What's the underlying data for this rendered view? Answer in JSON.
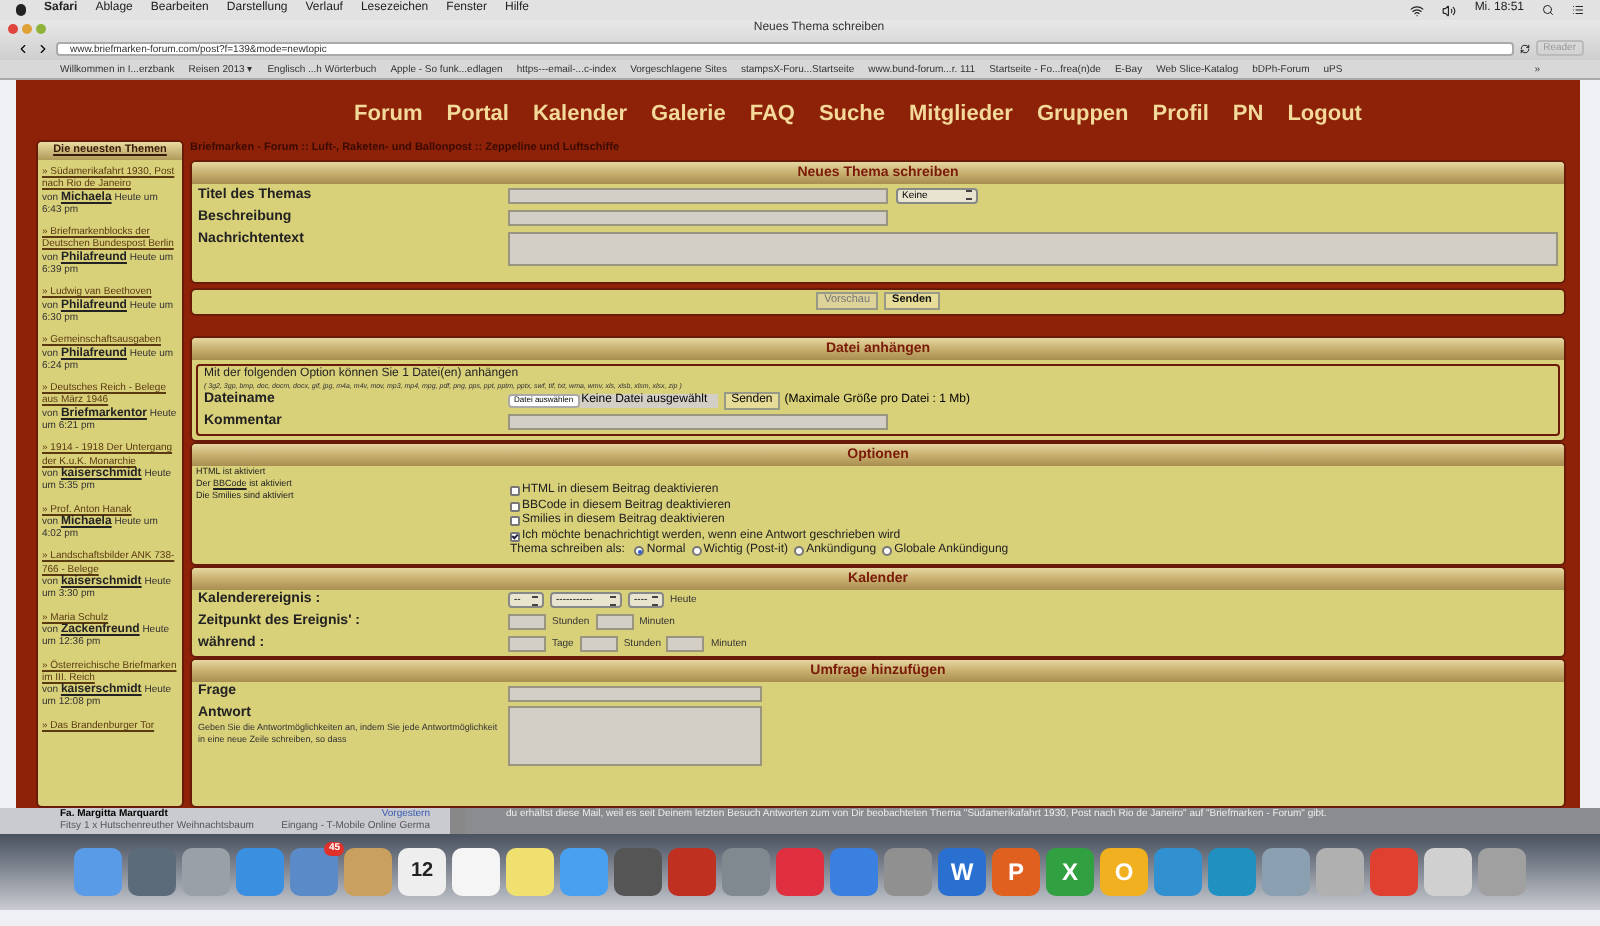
{
  "menubar": {
    "items": [
      "Safari",
      "Ablage",
      "Bearbeiten",
      "Darstellung",
      "Verlauf",
      "Lesezeichen",
      "Fenster",
      "Hilfe"
    ],
    "clock": "Mi. 18:51"
  },
  "window": {
    "title": "Neues Thema schreiben",
    "url": "www.briefmarken-forum.com/post?f=139&mode=newtopic",
    "reader": "Reader",
    "bookmarks": [
      "Willkommen in I...erzbank",
      "Reisen 2013 ▾",
      "Englisch ...h Wörterbuch",
      "Apple - So funk...edlagen",
      "https---email-...c-index",
      "Vorgeschlagene Sites",
      "stampsX-Foru...Startseite",
      "www.bund-forum...r. 111",
      "Startseite - Fo...frea(n)de",
      "E-Bay",
      "Web Slice-Katalog",
      "bDPh-Forum",
      "uPS"
    ],
    "more": "»"
  },
  "nav": [
    "Forum",
    "Portal",
    "Kalender",
    "Galerie",
    "FAQ",
    "Suche",
    "Mitglieder",
    "Gruppen",
    "Profil",
    "PN",
    "Logout"
  ],
  "breadcrumb": "Briefmarken - Forum :: Luft-, Raketen- und Ballonpost :: Zeppeline und Luftschiffe",
  "sidebar": {
    "title": "Die neuesten Themen",
    "items": [
      {
        "title": "» Südamerikafahrt 1930, Post nach Rio de Janeiro",
        "by": "von",
        "author": "Michaela",
        "time": "Heute um 6:43 pm"
      },
      {
        "title": "» Briefmarkenblocks der Deutschen Bundespost Berlin",
        "by": "von",
        "author": "Philafreund",
        "time": "Heute um 6:39 pm"
      },
      {
        "title": "» Ludwig van Beethoven",
        "by": "von",
        "author": "Philafreund",
        "time": "Heute um 6:30 pm"
      },
      {
        "title": "» Gemeinschaftsausgaben",
        "by": "von",
        "author": "Philafreund",
        "time": "Heute um 6:24 pm"
      },
      {
        "title": "» Deutsches Reich - Belege aus März 1946",
        "by": "von",
        "author": "Briefmarkentor",
        "time": "Heute um 6:21 pm"
      },
      {
        "title": "» 1914 - 1918 Der Untergang der K.u.K. Monarchie",
        "by": "von",
        "author": "kaiserschmidt",
        "time": "Heute um 5:35 pm"
      },
      {
        "title": "» Prof. Anton Hanak",
        "by": "von",
        "author": "Michaela",
        "time": "Heute um 4:02 pm"
      },
      {
        "title": "» Landschaftsbilder ANK 738-766 - Belege",
        "by": "von",
        "author": "kaiserschmidt",
        "time": "Heute um 3:30 pm"
      },
      {
        "title": "» Maria Schulz",
        "by": "von",
        "author": "Zackenfreund",
        "time": "Heute um 12:36 pm"
      },
      {
        "title": "» Österreichische Briefmarken im III. Reich",
        "by": "von",
        "author": "kaiserschmidt",
        "time": "Heute um 12:08 pm"
      },
      {
        "title": "» Das Brandenburger Tor"
      }
    ]
  },
  "new_topic": {
    "title": "Neues Thema schreiben",
    "fields": [
      {
        "label": "Titel des Themas",
        "kind": "text",
        "select": "Keine"
      },
      {
        "label": "Beschreibung",
        "kind": "text"
      },
      {
        "label": "Nachrichtentext",
        "kind": "textarea"
      }
    ],
    "buttons": [
      {
        "label": "Vorschau",
        "primary": false
      },
      {
        "label": "Senden",
        "primary": true
      }
    ]
  },
  "attachment": {
    "title": "Datei anhängen",
    "intro": "Mit der folgenden Option können Sie 1 Datei(en) anhängen",
    "extensions": "( 3g2, 3gp, bmp, doc, docm, docx, gif, jpg, m4a, m4v, mov, mp3, mp4, mpg, pdf, png, pps, ppt, pptm, pptx, swf, tif, txt, wma, wmv, xls, xlsb, xlsm, xlsx, zip )",
    "file_label": "Dateiname",
    "choose_button": "Datei auswählen",
    "no_file": "Keine Datei ausgewählt",
    "send_button": "Senden",
    "max_size": "(Maximale Größe pro Datei : 1 Mb)",
    "comment_label": "Kommentar"
  },
  "options": {
    "title": "Optionen",
    "notes": [
      {
        "before": "HTML ist aktiviert"
      },
      {
        "before": "Der",
        "link": "BBCode",
        "after": "ist aktiviert"
      },
      {
        "before": "Die Smilies sind aktiviert"
      }
    ],
    "checks": [
      {
        "label": "HTML in diesem Beitrag deaktivieren",
        "checked": false
      },
      {
        "label": "BBCode in diesem Beitrag deaktivieren",
        "checked": false
      },
      {
        "label": "Smilies in diesem Beitrag deaktivieren",
        "checked": false
      },
      {
        "label": "Ich möchte benachrichtigt werden, wenn eine Antwort geschrieben wird",
        "checked": true
      }
    ],
    "post_as_label": "Thema schreiben als:",
    "post_as": [
      {
        "label": "Normal",
        "selected": true
      },
      {
        "label": "Wichtig (Post-it)",
        "selected": false
      },
      {
        "label": "Ankündigung",
        "selected": false
      },
      {
        "label": "Globale Ankündigung",
        "selected": false
      }
    ]
  },
  "calendar": {
    "title": "Kalender",
    "rows": [
      {
        "label": "Kalenderereignis :",
        "items": [
          {
            "kind": "select",
            "value": "--"
          },
          {
            "kind": "select",
            "value": "-----------"
          },
          {
            "kind": "select",
            "value": "----"
          },
          {
            "kind": "text",
            "value": "Heute"
          }
        ]
      },
      {
        "label": "Zeitpunkt des Ereignis' :",
        "items": [
          {
            "kind": "input"
          },
          {
            "kind": "text",
            "value": "Stunden"
          },
          {
            "kind": "input"
          },
          {
            "kind": "text",
            "value": "Minuten"
          }
        ]
      },
      {
        "label": "während :",
        "items": [
          {
            "kind": "input"
          },
          {
            "kind": "text",
            "value": "Tage"
          },
          {
            "kind": "input"
          },
          {
            "kind": "text",
            "value": "Stunden"
          },
          {
            "kind": "input"
          },
          {
            "kind": "text",
            "value": "Minuten"
          }
        ]
      }
    ]
  },
  "poll": {
    "title": "Umfrage hinzufügen",
    "question_label": "Frage",
    "answer_label": "Antwort",
    "answer_help": "Geben Sie die Antwortmöglichkeiten an, indem Sie jede Antwortmöglichkeit in eine neue Zeile schreiben, so dass"
  },
  "mail": {
    "sender": "Fa. Margitta Marquardt",
    "date": "Vorgestern",
    "subject": "Fitsy 1 x Hutschenreuther Weihnachtsbaum",
    "mailbox": "Eingang - T-Mobile Online Germa",
    "body": "du erhältst diese Mail, weil es seit Deinem letzten Besuch Antworten zum von Dir beobachteten Thema \"Südamerikafahrt 1930, Post nach Rio de Janeiro\" auf \"Briefmarken - Forum\" gibt."
  },
  "dock": [
    {
      "color": "#5a9be8"
    },
    {
      "color": "#5b6b7a"
    },
    {
      "color": "#9aa0a8"
    },
    {
      "color": "#3a8fe0"
    },
    {
      "color": "#5a8ac8",
      "badge": "45"
    },
    {
      "color": "#c9a060"
    },
    {
      "color": "#eeeeee",
      "glyph": "12"
    },
    {
      "color": "#f5f5f5"
    },
    {
      "color": "#f0e070"
    },
    {
      "color": "#4aa0f0"
    },
    {
      "color": "#555555"
    },
    {
      "color": "#c03020"
    },
    {
      "color": "#808890"
    },
    {
      "color": "#e03040"
    },
    {
      "color": "#3a80e0"
    },
    {
      "color": "#909090"
    },
    {
      "color": "#2a70d0",
      "glyph": "W"
    },
    {
      "color": "#e06020",
      "glyph": "P"
    },
    {
      "color": "#30a040",
      "glyph": "X"
    },
    {
      "color": "#f0b020",
      "glyph": "O"
    },
    {
      "color": "#3090d0"
    },
    {
      "color": "#2090c0"
    },
    {
      "color": "#8aa0b0"
    },
    {
      "color": "#b0b0b0"
    },
    {
      "color": "#e04030"
    },
    {
      "color": "#d0d0d0"
    },
    {
      "color": "#a0a0a0"
    }
  ]
}
